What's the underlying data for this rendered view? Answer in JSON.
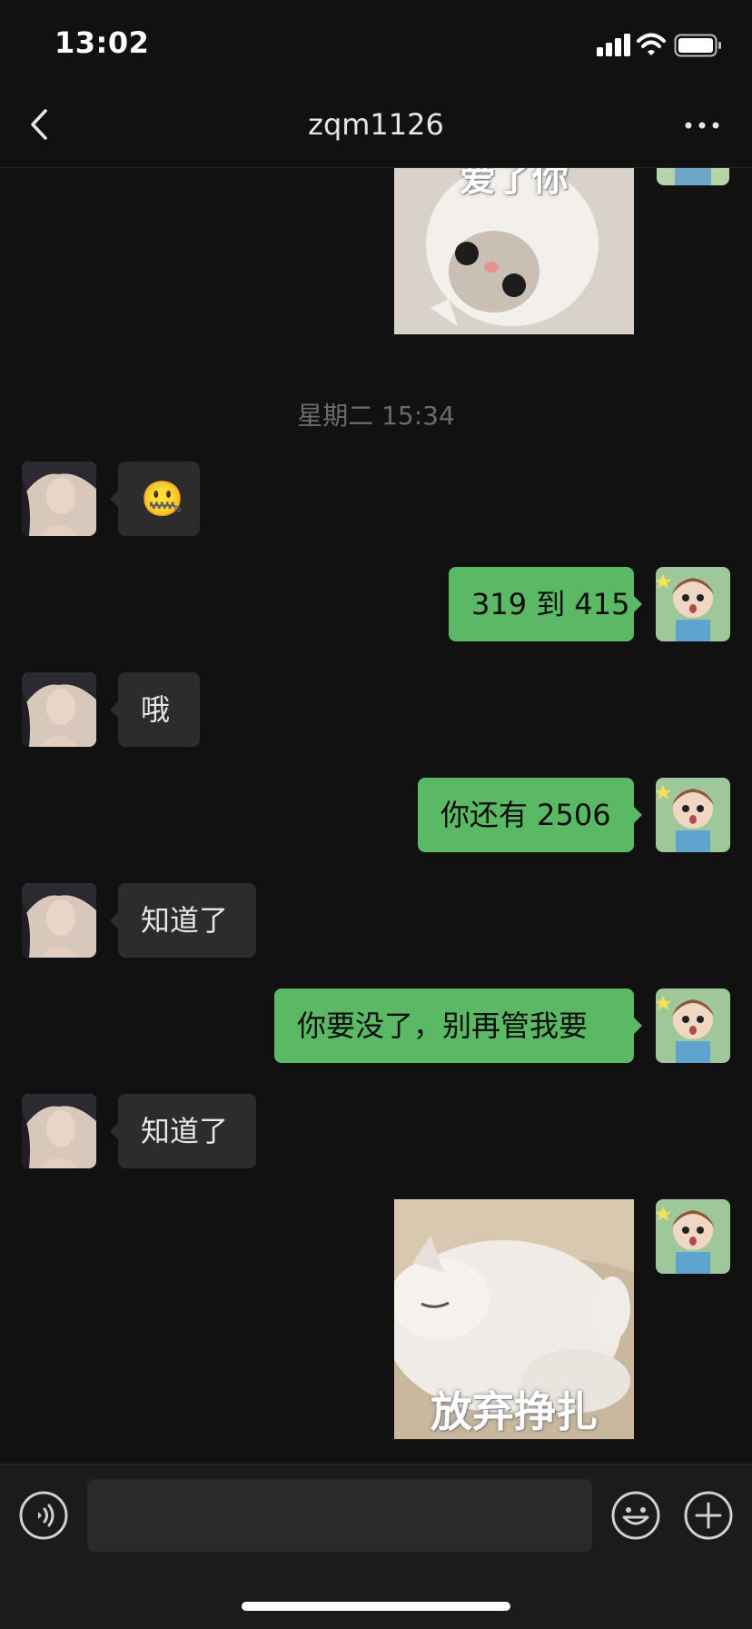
{
  "status_bar": {
    "time": "13:02"
  },
  "nav": {
    "title": "zqm1126"
  },
  "messages": [
    {
      "type": "sticker",
      "direction": "out",
      "caption": "爱了你"
    },
    {
      "type": "timestamp",
      "text": "星期二 15:34"
    },
    {
      "type": "emoji",
      "direction": "in",
      "text": "🤐"
    },
    {
      "type": "text",
      "direction": "out",
      "text": "319 到 415"
    },
    {
      "type": "text",
      "direction": "in",
      "text": "哦"
    },
    {
      "type": "text",
      "direction": "out",
      "text": "你还有 2506"
    },
    {
      "type": "text",
      "direction": "in",
      "text": "知道了"
    },
    {
      "type": "text",
      "direction": "out",
      "text": "你要没了，别再管我要"
    },
    {
      "type": "text",
      "direction": "in",
      "text": "知道了"
    },
    {
      "type": "sticker",
      "direction": "out",
      "caption": "放弃挣扎"
    }
  ],
  "colors": {
    "background": "#111111",
    "incoming_bubble": "#2c2c2c",
    "outgoing_bubble": "#5bb865"
  },
  "icons": {
    "back": "chevron-left-icon",
    "more": "ellipsis-icon",
    "voice": "voice-icon",
    "emoji": "smiley-icon",
    "add": "plus-circle-icon"
  }
}
